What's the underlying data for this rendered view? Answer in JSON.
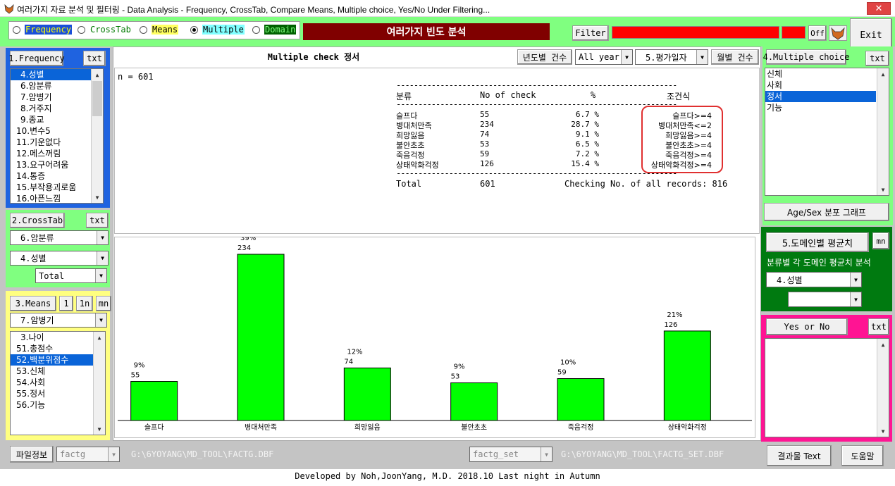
{
  "window": {
    "title": "여러가지 자료 분석 및 필터링 - Data Analysis - Frequency, CrossTab, Compare Means, Multiple choice, Yes/No Under Filtering...",
    "close": "✕"
  },
  "modes": [
    {
      "label": "Frequency",
      "color": "#ffff00",
      "bg": "#1a4fd8",
      "selected": false
    },
    {
      "label": "CrossTab",
      "color": "#007a00",
      "bg": "",
      "selected": false
    },
    {
      "label": "Means",
      "color": "#000",
      "bg": "#ffff60",
      "selected": false
    },
    {
      "label": "Multiple",
      "color": "#000",
      "bg": "#80ffff",
      "selected": true
    },
    {
      "label": "Domain",
      "color": "#80ff80",
      "bg": "#006000",
      "selected": false
    }
  ],
  "header": {
    "banner": "여러가지 빈도 분석",
    "filter": "Filter",
    "off": "Off",
    "exit": "Exit"
  },
  "freq": {
    "btn": "1.Frequency",
    "txt": "txt",
    "items": [
      "4.성별",
      "6.암분류",
      "7.암병기",
      "8.거주지",
      "9.종교",
      "10.변수5",
      "11.기운없다",
      "12.메스꺼림",
      "13.요구어려움",
      "14.통증",
      "15.부작용괴로움",
      "16.아픈느낌"
    ],
    "selected": 0
  },
  "cross": {
    "btn": "2.CrossTab",
    "txt": "txt",
    "combo1": "6.암분류",
    "combo2": "4.성별",
    "combo3": "Total"
  },
  "means": {
    "btn": "3.Means",
    "b1": "1",
    "b2": "1n",
    "b3": "mn",
    "combo": "7.암병기",
    "items": [
      "3.나이",
      "51.총점수",
      "52.백분위점수",
      "53.신체",
      "54.사회",
      "55.정서",
      "56.기능"
    ],
    "selected": 2
  },
  "center": {
    "title": "Multiple check 정서",
    "yearbtn": "년도별 건수",
    "yearcombo": "All year",
    "datecombo": "5.평가일자",
    "monthbtn": "월별 건수",
    "n": "n = 601"
  },
  "table": {
    "sep": "----------------------------------------------------------------",
    "headers": [
      "분류",
      "No of check",
      "%",
      "조건식"
    ],
    "rows": [
      [
        "슬프다",
        "55",
        "6.7  %",
        "슬프다>=4"
      ],
      [
        "병대처만족",
        "234",
        "28.7  %",
        "병대처만족<=2"
      ],
      [
        "희망잃음",
        "74",
        "9.1  %",
        "희망잃음>=4"
      ],
      [
        "불안초초",
        "53",
        "6.5  %",
        "불안초초>=4"
      ],
      [
        "죽음걱정",
        "59",
        "7.2  %",
        "죽음걱정>=4"
      ],
      [
        "상태악화걱정",
        "126",
        "15.4  %",
        "상태악화걱정>=4"
      ]
    ],
    "total_label": "Total",
    "total_value": "601",
    "total_note": "Checking No. of all records: 816"
  },
  "chart_data": {
    "type": "bar",
    "categories": [
      "슬프다",
      "병대처만족",
      "희망잃음",
      "불안초초",
      "죽음걱정",
      "상태악화걱정"
    ],
    "values": [
      55,
      234,
      74,
      53,
      59,
      126
    ],
    "percent_labels": [
      "9%",
      "39%",
      "12%",
      "9%",
      "10%",
      "21%"
    ],
    "bar_color": "#00ff00",
    "ylim": [
      0,
      234
    ]
  },
  "multi": {
    "btn": "4.Multiple choice",
    "txt": "txt",
    "items": [
      "신체",
      "사회",
      "정서",
      "기능"
    ],
    "selected": 2,
    "agesex": "Age/Sex 분포 그래프"
  },
  "domain": {
    "btn": "5.도메인별 평균치",
    "mn": "mn",
    "label": "분류별 각 도메인 평균치 분석",
    "combo1": "4.성별",
    "combo2": ""
  },
  "yesno": {
    "btn": "Yes or No",
    "txt": "txt"
  },
  "footer": {
    "fileinfo": "파일정보",
    "combo1": "factg",
    "path1": "G:\\6YOYANG\\MD_TOOL\\FACTG.DBF",
    "combo2": "factg_set",
    "path2": "G:\\6YOYANG\\MD_TOOL\\FACTG_SET.DBF",
    "result": "결과물 Text",
    "help": "도움말",
    "credit": "Developed by Noh,JoonYang, M.D. 2018.10  Last night in Autumn"
  }
}
